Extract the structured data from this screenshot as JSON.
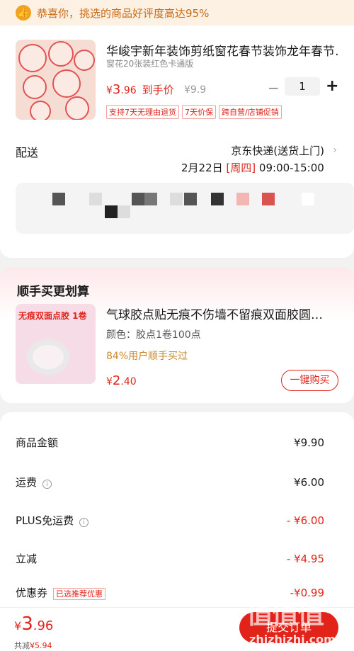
{
  "banner": {
    "text": "恭喜你，挑选的商品好评度高达95%"
  },
  "product": {
    "title": "华峻宇新年装饰剪纸窗花春节装饰龙年春节…",
    "spec": "窗花20张装红色卡通版",
    "price_symbol": "¥",
    "price_int": "3",
    "price_dec": ".96",
    "price_tag": "到手价",
    "orig_price": "¥9.9",
    "quantity": "1",
    "tags": [
      "支持7天无理由退货",
      "7天价保",
      "跨自营/店铺促销"
    ]
  },
  "delivery": {
    "label": "配送",
    "method": "京东快递(送货上门)",
    "date": "2月22日",
    "weekday": "[周四]",
    "time": "09:00-15:00"
  },
  "addon": {
    "section_title": "顺手买更划算",
    "thumb_text": "无痕双面点胶 1卷",
    "title": "气球胶点贴无痕不伤墙不留痕双面胶圆…",
    "spec": "颜色：胶点1卷100点",
    "hint": "84%用户顺手买过",
    "price_symbol": "¥",
    "price_int": "2",
    "price_dec": ".40",
    "buy_label": "一键购买"
  },
  "summary": {
    "goods_label": "商品金额",
    "goods_value": "¥9.90",
    "shipping_label": "运费",
    "shipping_value": "¥6.00",
    "plus_label": "PLUS免运费",
    "plus_value": "- ¥6.00",
    "discount_label": "立减",
    "discount_value": "- ¥4.95",
    "coupon_label": "优惠券",
    "coupon_tag": "已选推荐优惠",
    "coupon_value": "-¥0.99"
  },
  "footer": {
    "total_symbol": "¥",
    "total_int": "3",
    "total_dec": ".96",
    "save_label": "共减",
    "save_value": "¥5.94",
    "submit_label": "提交订单"
  },
  "watermark": {
    "text": "值值值",
    "sub": "zhizhizhi.com"
  },
  "colors": {
    "accent": "#e2231a",
    "banner_bg": "#fdf1e3",
    "banner_text": "#c96a13"
  }
}
